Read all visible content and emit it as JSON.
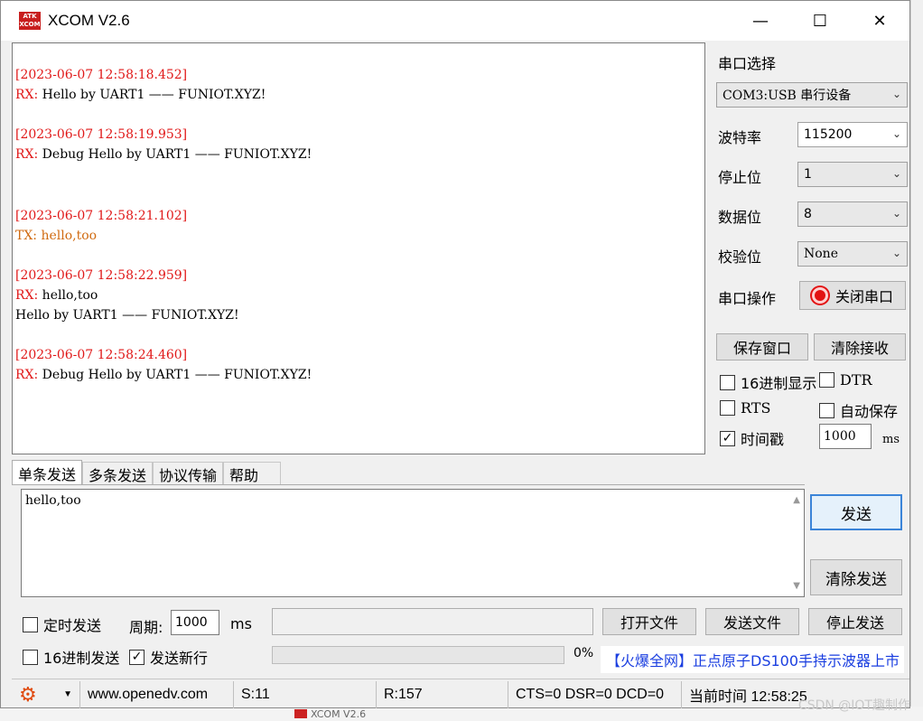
{
  "window": {
    "title": "XCOM V2.6",
    "logo_text": "ATK XCOM",
    "minimize": "—",
    "maximize": "☐",
    "close": "✕"
  },
  "receive": [
    {
      "ts": "[2023-06-07 12:58:18.452]",
      "lines": [
        {
          "label": "RX:",
          "text": " Hello by UART1 —— FUNIOT.XYZ!"
        }
      ]
    },
    {
      "ts": "[2023-06-07 12:58:19.953]",
      "lines": [
        {
          "label": "RX:",
          "text": " Debug Hello by UART1 —— FUNIOT.XYZ!"
        }
      ]
    },
    {
      "ts": "[2023-06-07 12:58:21.102]",
      "lines": [
        {
          "label": "TX:",
          "text": " hello,too"
        }
      ]
    },
    {
      "ts": "[2023-06-07 12:58:22.959]",
      "lines": [
        {
          "label": "RX:",
          "text": " hello,too"
        },
        {
          "label": "",
          "text": "Hello by UART1 —— FUNIOT.XYZ!"
        }
      ]
    },
    {
      "ts": "[2023-06-07 12:58:24.460]",
      "lines": [
        {
          "label": "RX:",
          "text": " Debug Hello by UART1 —— FUNIOT.XYZ!"
        }
      ]
    }
  ],
  "panel": {
    "port_label": "串口选择",
    "port_value": "COM3:USB 串行设备",
    "baud_label": "波特率",
    "baud_value": "115200",
    "stop_label": "停止位",
    "stop_value": "1",
    "data_label": "数据位",
    "data_value": "8",
    "parity_label": "校验位",
    "parity_value": "None",
    "op_label": "串口操作",
    "op_button": "关闭串口",
    "save_window": "保存窗口",
    "clear_recv": "清除接收",
    "hex_display": "16进制显示",
    "dtr": "DTR",
    "rts": "RTS",
    "auto_save": "自动保存",
    "timestamp": "时间戳",
    "timestamp_ms": "1000",
    "ms_unit": "ms",
    "check_mark": "✓"
  },
  "tabs": [
    "单条发送",
    "多条发送",
    "协议传输",
    "帮助"
  ],
  "send": {
    "text": "hello,too",
    "send_button": "发送",
    "clear_button": "清除发送",
    "timed_send": "定时发送",
    "period_label": "周期:",
    "period_value": "1000",
    "period_unit": "ms",
    "open_file": "打开文件",
    "send_file": "发送文件",
    "stop_send": "停止发送",
    "hex_send": "16进制发送",
    "send_newline": "发送新行",
    "progress_pct": "0%",
    "ad_text": "【火爆全网】正点原子DS100手持示波器上市"
  },
  "status": {
    "url": "www.openedv.com",
    "sent": "S:11",
    "received": "R:157",
    "lines": "CTS=0 DSR=0 DCD=0",
    "time": "当前时间 12:58:25"
  },
  "background": {
    "task_title": "XCOM V2.6",
    "watermark": "CSDN @IOT趣制作"
  }
}
